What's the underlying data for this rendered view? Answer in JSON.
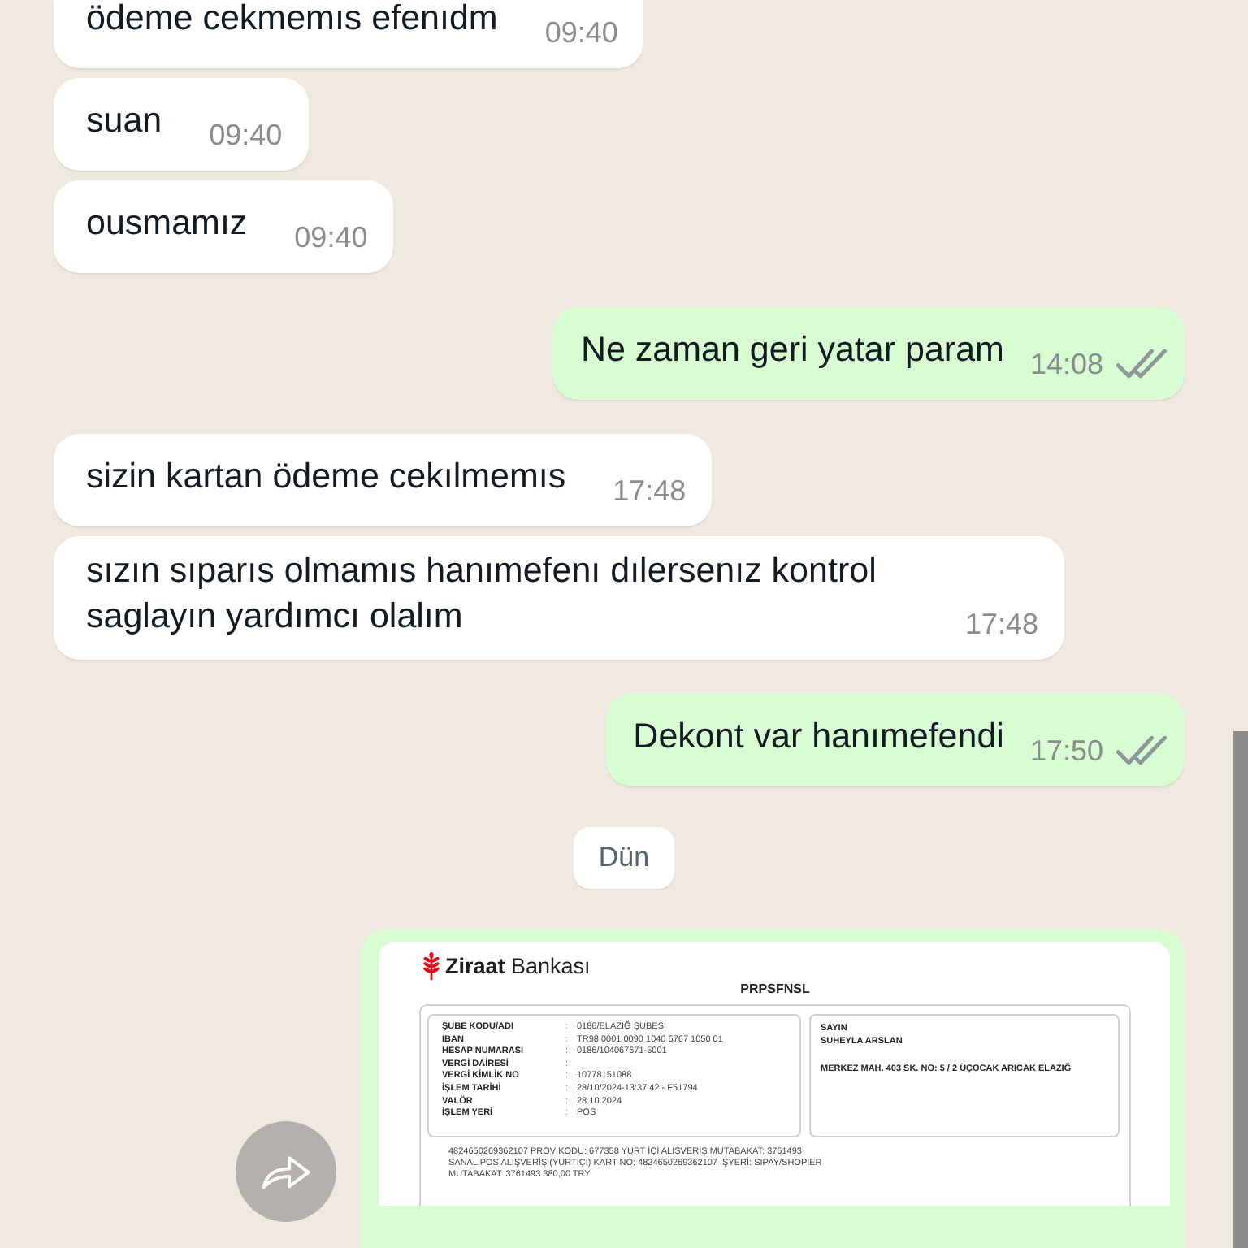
{
  "messages": [
    {
      "kind": "text",
      "outgoing": false,
      "text": "ödeme cekmemıs efenıdm",
      "time": "09:40"
    },
    {
      "kind": "text",
      "outgoing": false,
      "text": "suan",
      "time": "09:40"
    },
    {
      "kind": "text",
      "outgoing": false,
      "text": "ousmamız",
      "time": "09:40"
    },
    {
      "kind": "text",
      "outgoing": true,
      "text": "Ne zaman geri yatar param",
      "time": "14:08",
      "delivered": true,
      "read": false
    },
    {
      "kind": "text",
      "outgoing": false,
      "text": "sizin kartan ödeme cekılmemıs",
      "time": "17:48"
    },
    {
      "kind": "text",
      "outgoing": false,
      "text": "sızın sıparıs olmamıs hanımefenı dılersenız kontrol saglayın yardımcı olalım",
      "time": "17:48"
    },
    {
      "kind": "text",
      "outgoing": true,
      "text": "Dekont var hanımefendi",
      "time": "17:50",
      "delivered": true,
      "read": false
    },
    {
      "kind": "date",
      "text": "Dün"
    },
    {
      "kind": "document",
      "outgoing": true,
      "document": {
        "bank": "**Ziraat** Bankası",
        "code": "PRPSFNSL",
        "account_rows": [
          {
            "label": "ŞUBE KODU/ADI",
            "sep": ":",
            "value": "0186/ELAZIĞ ŞUBESİ"
          },
          {
            "label": "IBAN",
            "sep": ":",
            "value": "TR98 0001 0090 1040 6767 1050 01"
          },
          {
            "label": "HESAP NUMARASI",
            "sep": ":",
            "value": "0186/104067671-5001"
          },
          {
            "label": "VERGİ DAİRESİ",
            "sep": ":"
          },
          {
            "label": "VERGİ KİMLİK NO",
            "sep": ":",
            "value": "10778151088"
          },
          {
            "label": "İŞLEM TARİHİ",
            "sep": ":",
            "value": "28/10/2024-13:37:42 - F51794"
          },
          {
            "label": "VALÖR",
            "sep": ":",
            "value": "28.10.2024"
          },
          {
            "label": "İŞLEM YERİ",
            "sep": ":",
            "value": "POS"
          }
        ],
        "recipient": {
          "salutation": "SAYIN",
          "name": "SUHEYLA ARSLAN",
          "address": "MERKEZ MAH. 403 SK. NO: 5 / 2 ÜÇOCAK ARICAK ELAZIĞ"
        },
        "details_lines": [
          "4824650269362107 PROV KODU: 677358 YURT İÇİ ALIŞVERİŞ MUTABAKAT: 3761493",
          "SANAL POS ALIŞVERİŞ (YURTİÇİ) KART NO: 4824650269362107 İŞYERİ: SIPAY/SHOPIER",
          "MUTABAKAT: 3761493 380,00 TRY"
        ]
      }
    }
  ]
}
